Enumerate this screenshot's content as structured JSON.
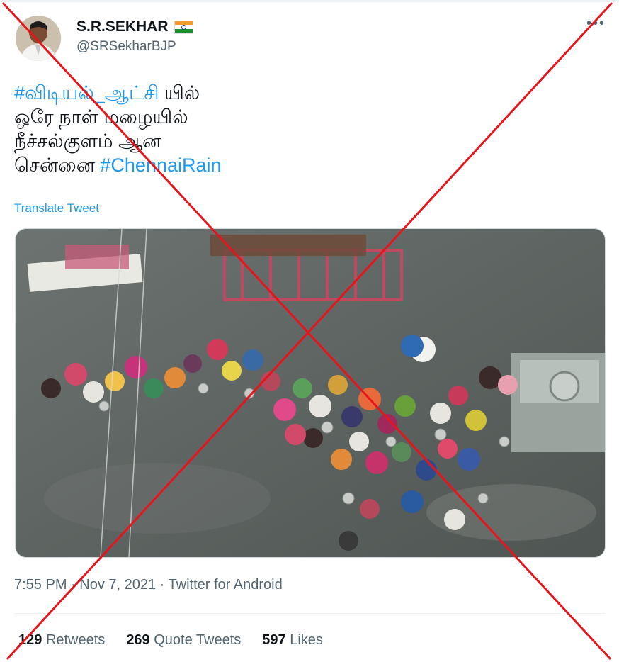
{
  "author": {
    "name": "S.R.SEKHAR",
    "handle": "@SRSekharBJP",
    "flag_icon": "india-flag-icon"
  },
  "menu_icon": "more-options-icon",
  "tweet": {
    "hashtag1": "#விடியல்_ஆட்சி",
    "line1_rest": " யில்",
    "line2": "ஒரே நாள் மழையில்",
    "line3": "நீச்சல்குளம் ஆன",
    "line4_text": "சென்னை ",
    "hashtag2": "#ChennaiRain"
  },
  "translate_label": "Translate Tweet",
  "media": {
    "alt": "Flooded street with people collecting water around a tanker"
  },
  "meta": {
    "time": "7:55 PM",
    "sep": " · ",
    "date": "Nov 7, 2021",
    "source": "Twitter for Android"
  },
  "stats": {
    "retweets_count": "129",
    "retweets_label": "Retweets",
    "quotes_count": "269",
    "quotes_label": "Quote Tweets",
    "likes_count": "597",
    "likes_label": "Likes"
  },
  "colors": {
    "link": "#1d9bf0",
    "overlay_cross": "#e8141b",
    "secondary_text": "#536471"
  }
}
